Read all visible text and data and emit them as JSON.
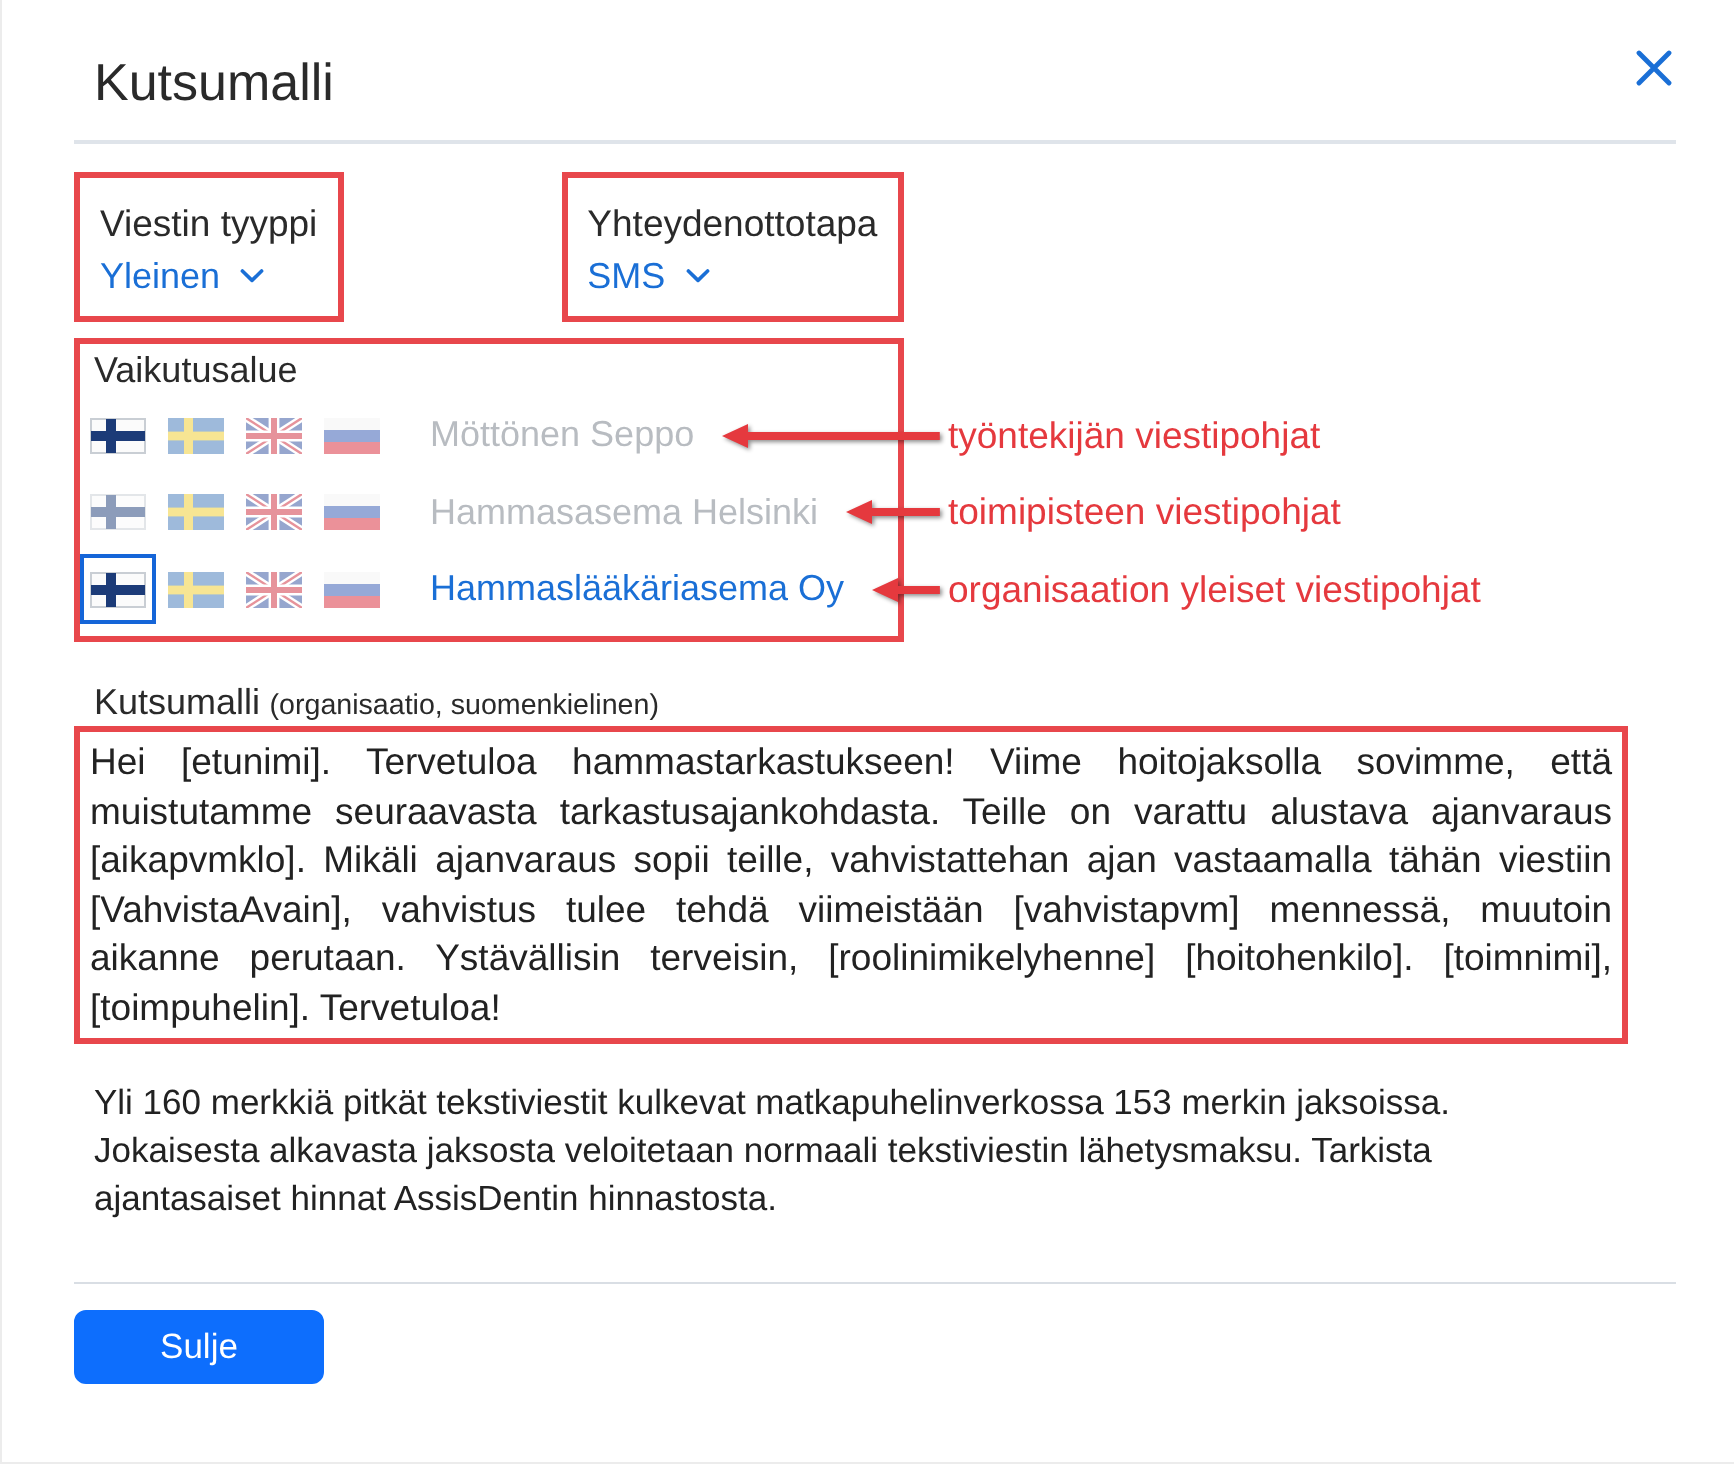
{
  "dialog": {
    "title": "Kutsumalli"
  },
  "message_type": {
    "label": "Viestin tyyppi",
    "value": "Yleinen",
    "highlighted": true
  },
  "contact_method": {
    "label": "Yhteydenottotapa",
    "value": "SMS",
    "highlighted": true
  },
  "scope": {
    "label": "Vaikutusalue",
    "highlighted": true,
    "rows": [
      {
        "name": "Möttönen Seppo",
        "disabled": true,
        "flags": [
          {
            "kind": "fi",
            "available": true,
            "selected": false
          },
          {
            "kind": "sv",
            "available": false,
            "selected": false
          },
          {
            "kind": "en",
            "available": false,
            "selected": false
          },
          {
            "kind": "ru",
            "available": false,
            "selected": false
          }
        ],
        "annotation": "työntekijän viestipohjat"
      },
      {
        "name": "Hammasasema Helsinki",
        "disabled": true,
        "flags": [
          {
            "kind": "fi",
            "available": false,
            "selected": false
          },
          {
            "kind": "sv",
            "available": false,
            "selected": false
          },
          {
            "kind": "en",
            "available": false,
            "selected": false
          },
          {
            "kind": "ru",
            "available": false,
            "selected": false
          }
        ],
        "annotation": "toimipisteen viestipohjat"
      },
      {
        "name": "Hammaslääkäriasema Oy",
        "disabled": false,
        "flags": [
          {
            "kind": "fi",
            "available": true,
            "selected": true
          },
          {
            "kind": "sv",
            "available": false,
            "selected": false
          },
          {
            "kind": "en",
            "available": false,
            "selected": false
          },
          {
            "kind": "ru",
            "available": false,
            "selected": false
          }
        ],
        "annotation": "organisaation yleiset viestipohjat"
      }
    ]
  },
  "template": {
    "label": "Kutsumalli",
    "note": "(organisaatio, suomenkielinen)",
    "highlighted": true,
    "text": "Hei [etunimi]. Tervetuloa hammastarkastukseen! Viime hoitojaksolla sovimme, että muistutamme seuraavasta tarkastusajankohdasta. Teille on varattu alustava ajanvaraus [aikapvmklo]. Mikäli ajanvaraus sopii teille, vahvistattehan ajan vastaamalla tähän viestiin [VahvistaAvain], vahvistus tulee tehdä viimeistään [vahvistapvm] mennessä, muutoin aikanne perutaan. Ystävällisin terveisin, [roolinimikelyhenne] [hoitohenkilo]. [toimnimi], [toimpuhelin]. Tervetuloa!"
  },
  "info": "Yli 160 merkkiä pitkät tekstiviestit kulkevat matkapuhelinverkossa 153 merkin jaksoissa. Jokaisesta alkavasta jaksosta veloitetaan normaali tekstiviestin lähetysmaksu. Tarkista ajantasaiset hinnat AssisDentin hinnastosta.",
  "buttons": [
    "Sulje"
  ]
}
